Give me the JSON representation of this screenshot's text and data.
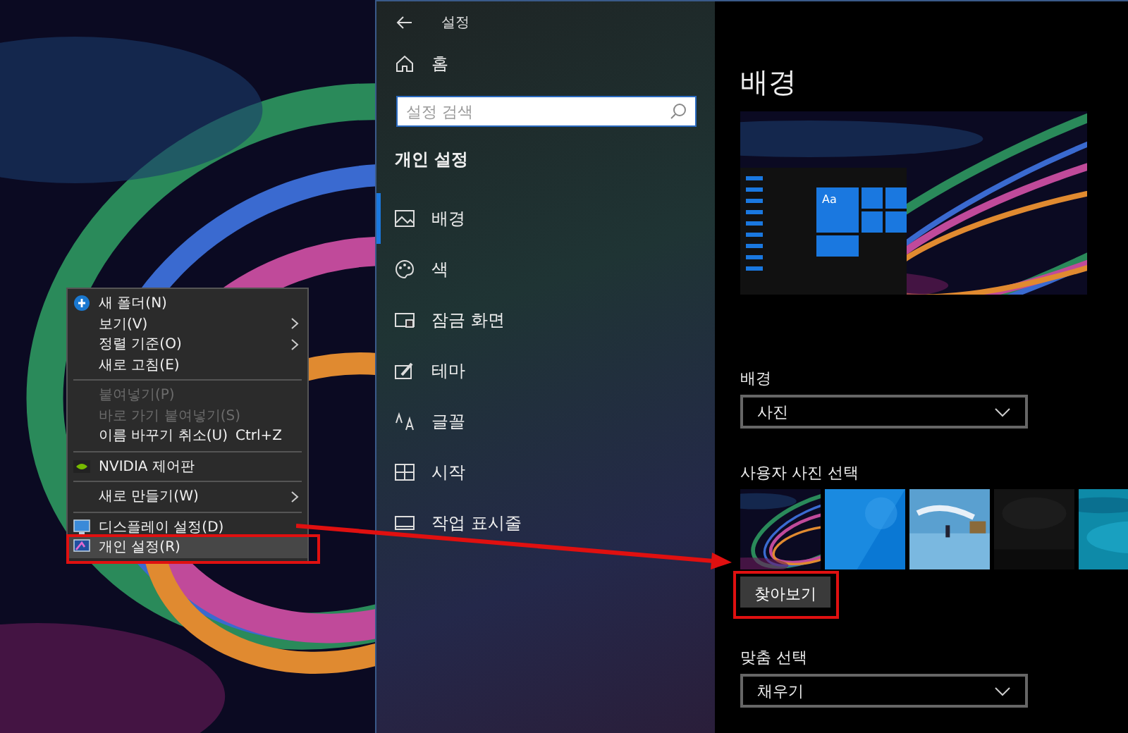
{
  "context_menu": {
    "items": [
      {
        "kind": "item",
        "label": "새 폴더(N)",
        "disabled": false,
        "submenu": false,
        "highlighted": false
      },
      {
        "kind": "item",
        "label": "보기(V)",
        "disabled": false,
        "submenu": true,
        "highlighted": false
      },
      {
        "kind": "item",
        "label": "정렬 기준(O)",
        "disabled": false,
        "submenu": true,
        "highlighted": false
      },
      {
        "kind": "item",
        "label": "새로 고침(E)",
        "disabled": false,
        "submenu": false,
        "highlighted": false
      },
      {
        "kind": "separator"
      },
      {
        "kind": "item",
        "label": "붙여넣기(P)",
        "disabled": true,
        "submenu": false,
        "highlighted": false
      },
      {
        "kind": "item",
        "label": "바로 가기 붙여넣기(S)",
        "disabled": true,
        "submenu": false,
        "highlighted": false
      },
      {
        "kind": "item",
        "label": "이름 바꾸기 취소(U)",
        "shortcut": "Ctrl+Z",
        "disabled": false,
        "submenu": false,
        "highlighted": false
      },
      {
        "kind": "separator"
      },
      {
        "kind": "item",
        "label": "NVIDIA 제어판",
        "disabled": false,
        "submenu": false,
        "highlighted": false
      },
      {
        "kind": "separator"
      },
      {
        "kind": "item",
        "label": "새로 만들기(W)",
        "disabled": false,
        "submenu": true,
        "highlighted": false
      },
      {
        "kind": "separator"
      },
      {
        "kind": "item",
        "label": "디스플레이 설정(D)",
        "disabled": false,
        "submenu": false,
        "highlighted": false
      },
      {
        "kind": "item",
        "label": "개인 설정(R)",
        "disabled": false,
        "submenu": false,
        "highlighted": true
      }
    ]
  },
  "settings": {
    "window": {
      "title": "설정"
    },
    "sidebar": {
      "home": "홈",
      "search": {
        "placeholder": "설정 검색"
      },
      "section": "개인 설정",
      "items": [
        {
          "label": "배경",
          "selected": true
        },
        {
          "label": "색",
          "selected": false
        },
        {
          "label": "잠금 화면",
          "selected": false
        },
        {
          "label": "테마",
          "selected": false
        },
        {
          "label": "글꼴",
          "selected": false
        },
        {
          "label": "시작",
          "selected": false
        },
        {
          "label": "작업 표시줄",
          "selected": false
        }
      ]
    },
    "content": {
      "heading": "배경",
      "preview": {
        "sample_text": "Aa"
      },
      "background": {
        "label": "배경",
        "value": "사진"
      },
      "photos": {
        "label": "사용자 사진 선택"
      },
      "browse_button": {
        "label": "찾아보기",
        "highlighted": true
      },
      "fit": {
        "label": "맞춤 선택",
        "value": "채우기"
      }
    }
  }
}
